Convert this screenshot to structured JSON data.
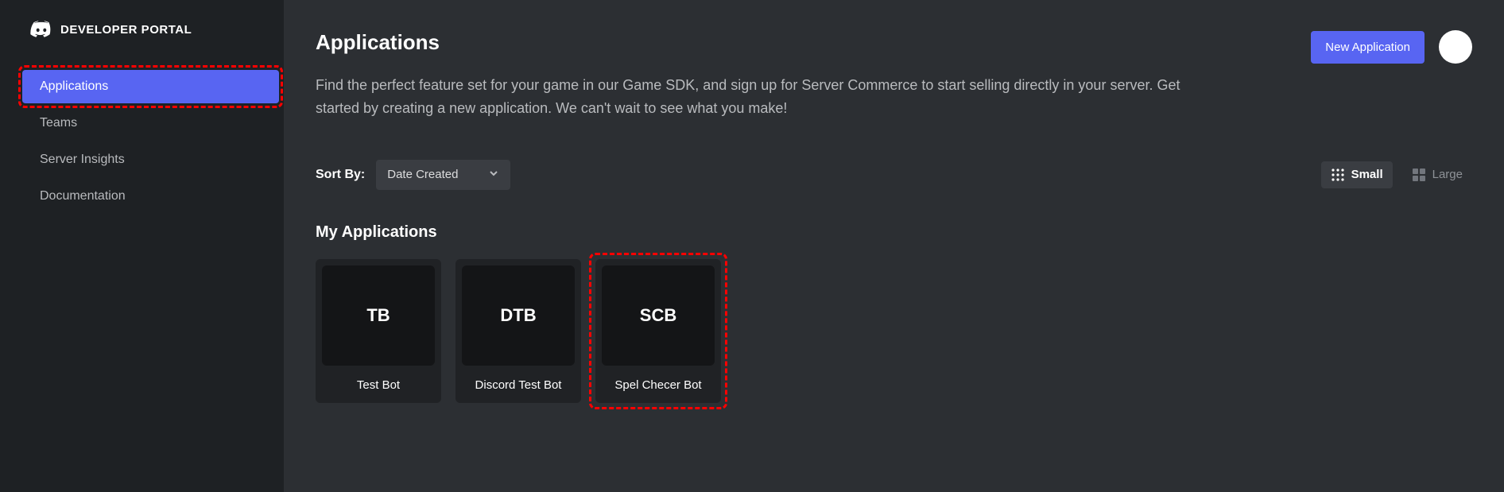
{
  "brand": {
    "text": "DEVELOPER PORTAL"
  },
  "sidebar": {
    "items": [
      {
        "label": "Applications",
        "active": true,
        "highlighted": true
      },
      {
        "label": "Teams"
      },
      {
        "label": "Server Insights"
      },
      {
        "label": "Documentation"
      }
    ]
  },
  "header": {
    "title": "Applications",
    "new_button": "New Application",
    "description": "Find the perfect feature set for your game in our Game SDK, and sign up for Server Commerce to start selling directly in your server. Get started by creating a new application. We can't wait to see what you make!"
  },
  "sort": {
    "label": "Sort By:",
    "value": "Date Created"
  },
  "view": {
    "small": "Small",
    "large": "Large",
    "active": "small"
  },
  "section": {
    "title": "My Applications"
  },
  "apps": [
    {
      "initials": "TB",
      "name": "Test Bot"
    },
    {
      "initials": "DTB",
      "name": "Discord Test Bot"
    },
    {
      "initials": "SCB",
      "name": "Spel Checer Bot",
      "highlighted": true
    }
  ],
  "colors": {
    "accent": "#5865f2",
    "bg": "#2c2f33",
    "sidebar": "#1e2124",
    "card": "#202225",
    "tile": "#141517"
  }
}
